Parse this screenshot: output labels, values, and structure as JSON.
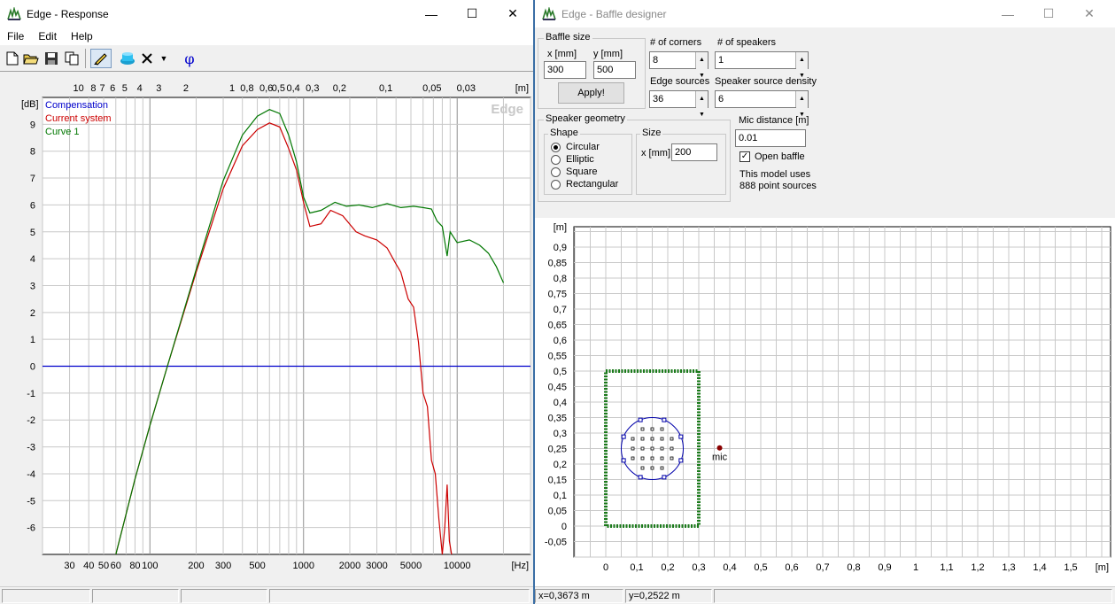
{
  "response": {
    "title": "Edge - Response",
    "menu": [
      "File",
      "Edit",
      "Help"
    ],
    "watermark": "Edge",
    "legend": [
      {
        "name": "Compensation",
        "color": "#0000cc"
      },
      {
        "name": "Current system",
        "color": "#cc0000"
      },
      {
        "name": "Curve 1",
        "color": "#007700"
      }
    ],
    "phase_button": "φ",
    "status": [
      "",
      "",
      "",
      ""
    ]
  },
  "baffle": {
    "title": "Edge - Baffle designer",
    "baffle_size": {
      "label": "Baffle size",
      "x_label": "x [mm]",
      "y_label": "y [mm]",
      "x": "300",
      "y": "500"
    },
    "apply": "Apply!",
    "corners": {
      "label": "# of corners",
      "value": "8"
    },
    "speakers": {
      "label": "# of speakers",
      "value": "1"
    },
    "edge_sources": {
      "label": "Edge sources",
      "value": "36"
    },
    "source_density": {
      "label": "Speaker source density",
      "value": "6"
    },
    "geometry": {
      "label": "Speaker geometry",
      "shape_label": "Shape",
      "shapes": [
        "Circular",
        "Elliptic",
        "Square",
        "Rectangular"
      ],
      "selected": "Circular",
      "size_label": "Size",
      "x_label": "x [mm]",
      "x": "200"
    },
    "mic_distance": {
      "label": "Mic distance [m]",
      "value": "0.01"
    },
    "open_baffle": {
      "label": "Open baffle",
      "checked": true
    },
    "info1": "This model uses",
    "info2": "888 point sources",
    "mic_label": "mic",
    "status_x": "x=0,3673 m",
    "status_y": "y=0,2522 m"
  },
  "chart_data": [
    {
      "type": "line",
      "xlabel": "[Hz]",
      "ylabel": "[dB]",
      "x_scale": "log",
      "xlim": [
        20,
        30000
      ],
      "ylim": [
        -7,
        10
      ],
      "grid": true,
      "legend_position": "top-left",
      "x_ticks": [
        "30",
        "40",
        "50",
        "60",
        "80",
        "100",
        "200",
        "300",
        "500",
        "1000",
        "2000",
        "3000",
        "5000",
        "10000"
      ],
      "y_ticks": [
        "9",
        "8",
        "7",
        "6",
        "5",
        "4",
        "3",
        "2",
        "1",
        "0",
        "-1",
        "-2",
        "-3",
        "-4",
        "-5",
        "-6"
      ],
      "top_axis_label": "[m]",
      "top_ticks": [
        "10",
        "8",
        "7",
        "6",
        "5",
        "4",
        "3",
        "2",
        "1",
        "0,8",
        "0,6",
        "0,5",
        "0,4",
        "0,3",
        "0,2",
        "0,1",
        "0,05",
        "0,03"
      ],
      "series": [
        {
          "name": "Compensation",
          "x": [
            20,
            30000
          ],
          "y": [
            0,
            0
          ]
        },
        {
          "name": "Current system",
          "x": [
            60,
            80,
            100,
            130,
            200,
            300,
            400,
            500,
            600,
            700,
            800,
            900,
            1000,
            1100,
            1300,
            1500,
            1800,
            2200,
            2500,
            3000,
            3500,
            4000,
            4300,
            4800,
            5200,
            5600,
            6000,
            6400,
            6800,
            7200,
            7600,
            8000,
            8300,
            8600,
            8900,
            9200
          ],
          "y": [
            -7,
            -4.2,
            -2.2,
            0,
            3.5,
            6.6,
            8.2,
            8.8,
            9.05,
            8.9,
            8.1,
            7.3,
            6.1,
            5.2,
            5.3,
            5.8,
            5.6,
            5.0,
            4.85,
            4.7,
            4.4,
            3.8,
            3.5,
            2.5,
            2.2,
            0.9,
            -1.0,
            -1.5,
            -3.5,
            -4.0,
            -5.7,
            -7,
            -6.0,
            -4.4,
            -6.5,
            -7
          ]
        },
        {
          "name": "Curve 1",
          "x": [
            60,
            80,
            100,
            130,
            200,
            300,
            400,
            500,
            600,
            700,
            800,
            900,
            1000,
            1100,
            1300,
            1600,
            1900,
            2300,
            2800,
            3500,
            4300,
            5200,
            6000,
            6800,
            7400,
            8000,
            8600,
            9000,
            10000,
            12000,
            14000,
            16000,
            18000,
            20000
          ],
          "y": [
            -7,
            -4.2,
            -2.2,
            0,
            3.6,
            6.9,
            8.6,
            9.3,
            9.55,
            9.4,
            8.6,
            7.6,
            6.3,
            5.7,
            5.8,
            6.1,
            5.95,
            6.0,
            5.9,
            6.05,
            5.9,
            5.95,
            5.9,
            5.85,
            5.4,
            5.2,
            4.1,
            5.0,
            4.6,
            4.7,
            4.5,
            4.2,
            3.7,
            3.1
          ]
        }
      ]
    },
    {
      "type": "scatter",
      "xlabel": "[m]",
      "ylabel": "[m]",
      "xlim": [
        -0.1,
        1.6
      ],
      "ylim": [
        -0.1,
        1.0
      ],
      "grid": true,
      "x_ticks": [
        "0",
        "0,1",
        "0,2",
        "0,3",
        "0,4",
        "0,5",
        "0,6",
        "0,7",
        "0,8",
        "0,9",
        "1",
        "1,1",
        "1,2",
        "1,3",
        "1,4",
        "1,5"
      ],
      "y_ticks": [
        "0,9",
        "0,85",
        "0,8",
        "0,75",
        "0,7",
        "0,65",
        "0,6",
        "0,55",
        "0,5",
        "0,45",
        "0,4",
        "0,35",
        "0,3",
        "0,25",
        "0,2",
        "0,15",
        "0,1",
        "0,05",
        "0",
        "-0,05"
      ],
      "baffle_rect": {
        "x": [
          0,
          0.3
        ],
        "y": [
          0,
          0.5
        ]
      },
      "speaker_circle": {
        "cx": 0.15,
        "cy": 0.25,
        "r": 0.1
      },
      "mic": {
        "x": 0.3673,
        "y": 0.2522
      }
    }
  ]
}
